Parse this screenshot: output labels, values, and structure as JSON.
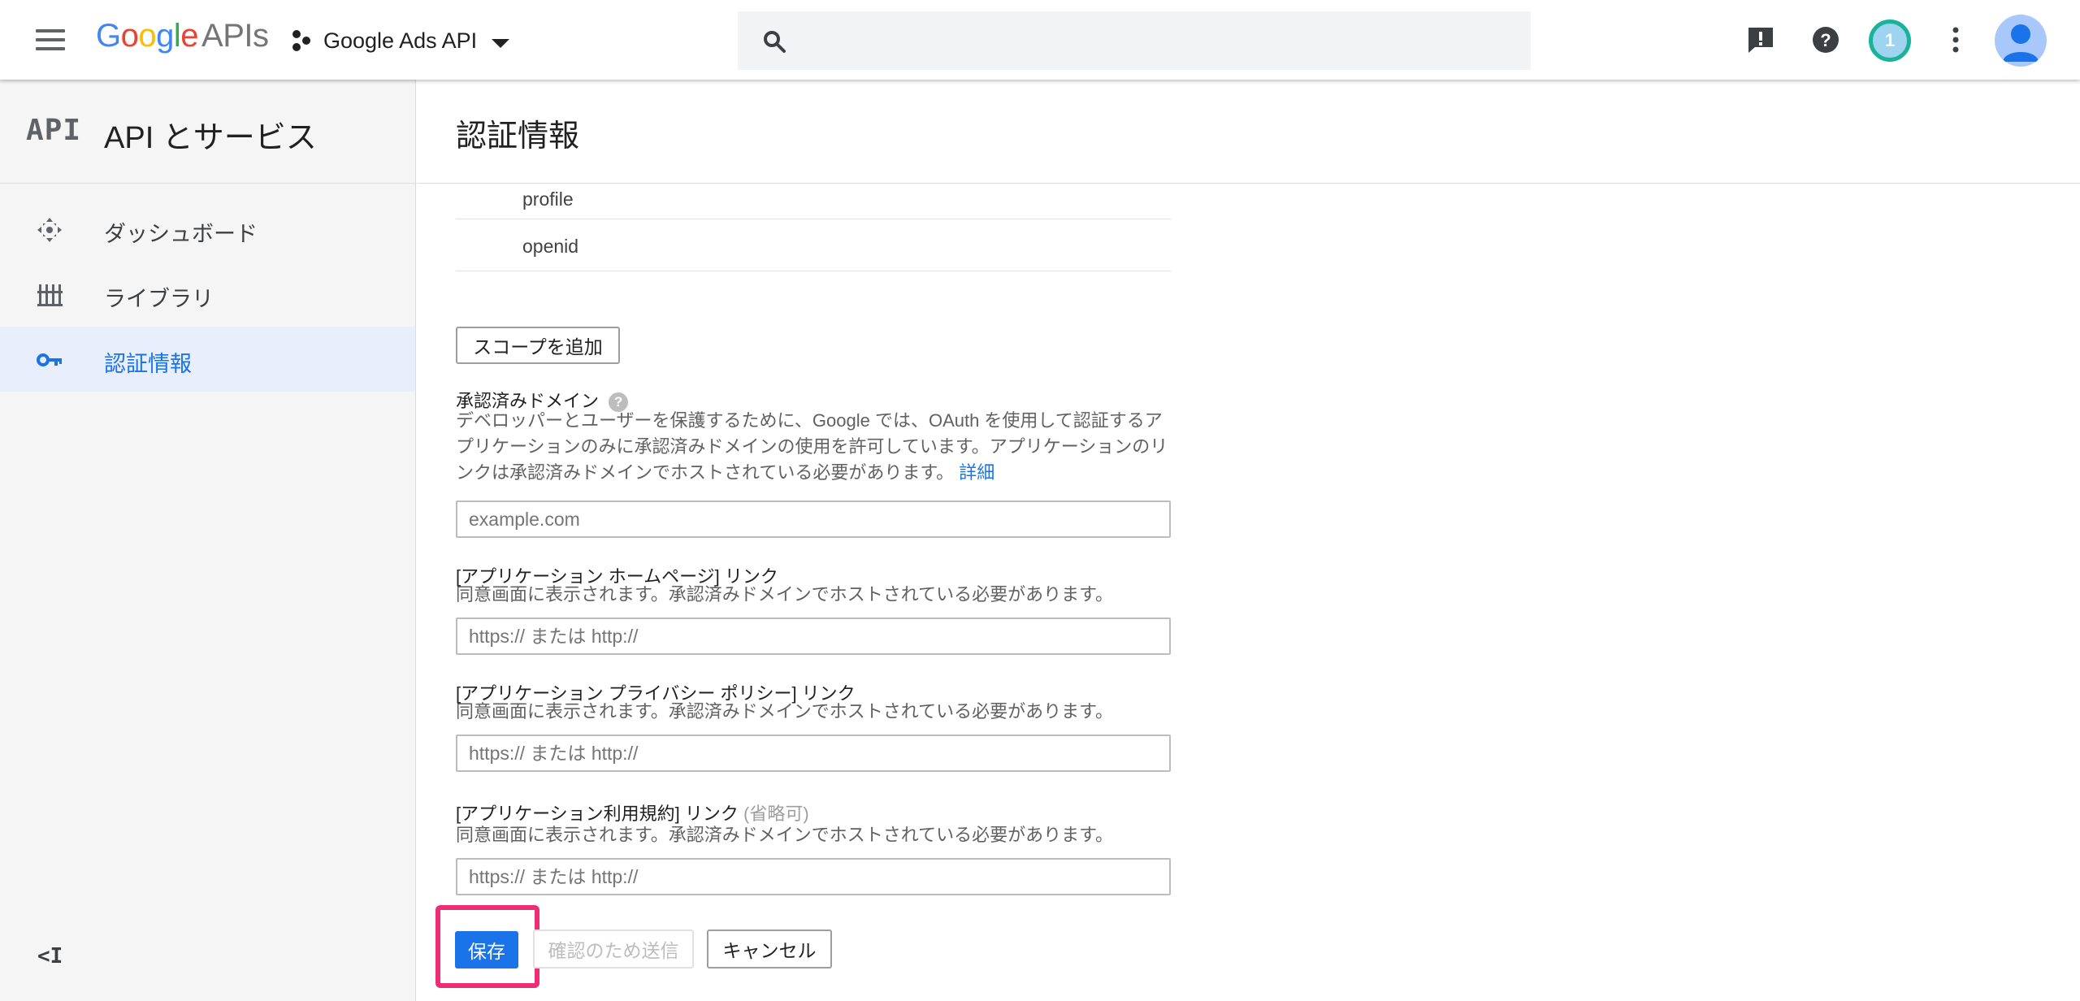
{
  "header": {
    "logo_google": "Google",
    "logo_apis": "APIs",
    "project_name": "Google Ads API",
    "search_placeholder": "",
    "notification_count": "1"
  },
  "sidebar": {
    "api_logo": "API",
    "title": "API とサービス",
    "items": [
      {
        "label": "ダッシュボード",
        "icon": "dashboard-icon"
      },
      {
        "label": "ライブラリ",
        "icon": "library-icon"
      },
      {
        "label": "認証情報",
        "icon": "key-icon",
        "active": true
      }
    ],
    "collapse_label": "<I"
  },
  "main": {
    "title": "認証情報",
    "scopes": [
      "profile",
      "openid"
    ],
    "add_scope_label": "スコープを追加",
    "authorized_domains": {
      "label": "承認済みドメイン",
      "description": "デベロッパーとユーザーを保護するために、Google では、OAuth を使用して認証するアプリケーションのみに承認済みドメインの使用を許可しています。アプリケーションのリンクは承認済みドメインでホストされている必要があります。",
      "details_link": "詳細",
      "placeholder": "example.com"
    },
    "homepage": {
      "label": "[アプリケーション ホームページ] リンク",
      "description": "同意画面に表示されます。承認済みドメインでホストされている必要があります。",
      "placeholder": "https:// または http://"
    },
    "privacy": {
      "label": "[アプリケーション プライバシー ポリシー] リンク",
      "description": "同意画面に表示されます。承認済みドメインでホストされている必要があります。",
      "placeholder": "https:// または http://"
    },
    "terms": {
      "label": "[アプリケーション利用規約] リンク",
      "optional": "(省略可)",
      "description": "同意画面に表示されます。承認済みドメインでホストされている必要があります。",
      "placeholder": "https:// または http://"
    },
    "buttons": {
      "save": "保存",
      "submit_for_verification": "確認のため送信",
      "cancel": "キャンセル"
    }
  },
  "colors": {
    "accent": "#1a73e8",
    "highlight": "#ee2e74",
    "badge_ring": "#1ab39a"
  }
}
